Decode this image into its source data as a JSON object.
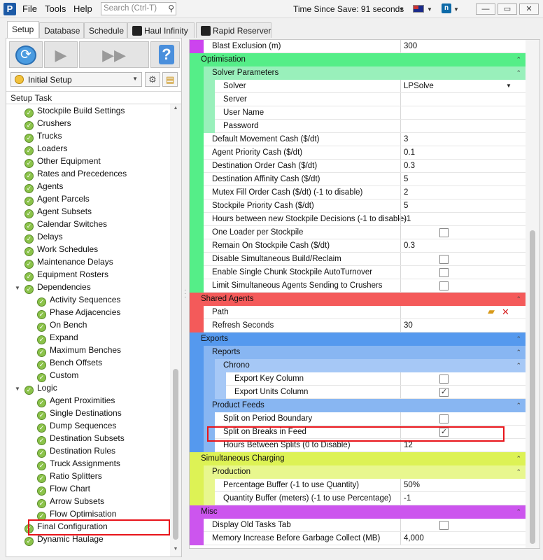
{
  "titlebar": {
    "logo_letter": "P",
    "menus": [
      "File",
      "Tools",
      "Help"
    ],
    "search_placeholder": "Search (Ctrl-T)",
    "time_since_save": "Time Since Save: 91 seconds",
    "window_buttons": [
      "—",
      "▭",
      "✕"
    ]
  },
  "tabs": [
    {
      "label": "Setup",
      "active": true
    },
    {
      "label": "Database",
      "active": false
    },
    {
      "label": "Schedule",
      "active": false
    },
    {
      "label": "Haul Infinity",
      "active": false
    },
    {
      "label": "Rapid Reserver",
      "active": false
    }
  ],
  "left": {
    "combo_value": "Initial Setup",
    "setup_task_header": "Setup Task",
    "tree": [
      {
        "label": "Stockpile Build Settings",
        "level": 1
      },
      {
        "label": "Crushers",
        "level": 1
      },
      {
        "label": "Trucks",
        "level": 1
      },
      {
        "label": "Loaders",
        "level": 1
      },
      {
        "label": "Other Equipment",
        "level": 1
      },
      {
        "label": "Rates and Precedences",
        "level": 1
      },
      {
        "label": "Agents",
        "level": 1
      },
      {
        "label": "Agent Parcels",
        "level": 1
      },
      {
        "label": "Agent Subsets",
        "level": 1
      },
      {
        "label": "Calendar Switches",
        "level": 1
      },
      {
        "label": "Delays",
        "level": 1
      },
      {
        "label": "Work Schedules",
        "level": 1
      },
      {
        "label": "Maintenance Delays",
        "level": 1
      },
      {
        "label": "Equipment Rosters",
        "level": 1
      },
      {
        "label": "Dependencies",
        "level": 1,
        "expandable": true
      },
      {
        "label": "Activity Sequences",
        "level": 2
      },
      {
        "label": "Phase Adjacencies",
        "level": 2
      },
      {
        "label": "On Bench",
        "level": 2
      },
      {
        "label": "Expand",
        "level": 2
      },
      {
        "label": "Maximum Benches",
        "level": 2
      },
      {
        "label": "Bench Offsets",
        "level": 2
      },
      {
        "label": "Custom",
        "level": 2
      },
      {
        "label": "Logic",
        "level": 1,
        "expandable": true
      },
      {
        "label": "Agent Proximities",
        "level": 2
      },
      {
        "label": "Single Destinations",
        "level": 2
      },
      {
        "label": "Dump Sequences",
        "level": 2
      },
      {
        "label": "Destination Subsets",
        "level": 2
      },
      {
        "label": "Destination Rules",
        "level": 2
      },
      {
        "label": "Truck Assignments",
        "level": 2
      },
      {
        "label": "Ratio Splitters",
        "level": 2
      },
      {
        "label": "Flow Chart",
        "level": 2
      },
      {
        "label": "Arrow Subsets",
        "level": 2
      },
      {
        "label": "Flow Optimisation",
        "level": 2
      },
      {
        "label": "Final Configuration",
        "level": 1,
        "highlighted": true
      },
      {
        "label": "Dynamic Haulage",
        "level": 1
      }
    ]
  },
  "grid": {
    "colors": {
      "magenta": "#cc44ee",
      "green": "#55ee88",
      "green_light": "#99f0bb",
      "red": "#f45a5a",
      "blue": "#5599ee",
      "blue_mid": "#88b6f2",
      "blue_light": "#a6c8f6",
      "yellow": "#ddf255",
      "yellow_light": "#e8f78e",
      "purple": "#cc55ee"
    },
    "rows": [
      {
        "kind": "prop",
        "label": "Blast Exclusion (m)",
        "value": "300",
        "indent": 1,
        "bars": [
          "magenta"
        ]
      },
      {
        "kind": "cat",
        "label": "Optimisation",
        "indent": 0,
        "color": "green"
      },
      {
        "kind": "cat",
        "label": "Solver Parameters",
        "indent": 1,
        "color": "green_light",
        "bars": [
          "green"
        ]
      },
      {
        "kind": "prop",
        "label": "Solver",
        "value": "LPSolve",
        "dropdown": true,
        "indent": 2,
        "bars": [
          "green",
          "green_light"
        ]
      },
      {
        "kind": "prop",
        "label": "Server",
        "value": "",
        "indent": 2,
        "bars": [
          "green",
          "green_light"
        ]
      },
      {
        "kind": "prop",
        "label": "User Name",
        "value": "",
        "indent": 2,
        "bars": [
          "green",
          "green_light"
        ]
      },
      {
        "kind": "prop",
        "label": "Password",
        "value": "",
        "indent": 2,
        "bars": [
          "green",
          "green_light"
        ]
      },
      {
        "kind": "prop",
        "label": "Default Movement Cash ($/dt)",
        "value": "3",
        "indent": 1,
        "bars": [
          "green"
        ]
      },
      {
        "kind": "prop",
        "label": "Agent Priority Cash ($/dt)",
        "value": "0.1",
        "indent": 1,
        "bars": [
          "green"
        ]
      },
      {
        "kind": "prop",
        "label": "Destination Order Cash ($/dt)",
        "value": "0.3",
        "indent": 1,
        "bars": [
          "green"
        ]
      },
      {
        "kind": "prop",
        "label": "Destination Affinity Cash ($/dt)",
        "value": "5",
        "indent": 1,
        "bars": [
          "green"
        ]
      },
      {
        "kind": "prop",
        "label": "Mutex Fill Order Cash ($/dt) (-1 to disable)",
        "value": "2",
        "indent": 1,
        "bars": [
          "green"
        ]
      },
      {
        "kind": "prop",
        "label": "Stockpile Priority Cash ($/dt)",
        "value": "5",
        "indent": 1,
        "bars": [
          "green"
        ]
      },
      {
        "kind": "prop",
        "label": "Hours between new Stockpile Decisions (-1 to disable)",
        "value": "-1",
        "indent": 1,
        "bars": [
          "green"
        ]
      },
      {
        "kind": "prop",
        "label": "One Loader per Stockpile",
        "checkbox": true,
        "checked": false,
        "indent": 1,
        "bars": [
          "green"
        ]
      },
      {
        "kind": "prop",
        "label": "Remain On Stockpile Cash ($/dt)",
        "value": "0.3",
        "indent": 1,
        "bars": [
          "green"
        ]
      },
      {
        "kind": "prop",
        "label": "Disable Simultaneous Build/Reclaim",
        "checkbox": true,
        "checked": false,
        "indent": 1,
        "bars": [
          "green"
        ]
      },
      {
        "kind": "prop",
        "label": "Enable Single Chunk Stockpile AutoTurnover",
        "checkbox": true,
        "checked": false,
        "indent": 1,
        "bars": [
          "green"
        ]
      },
      {
        "kind": "prop",
        "label": "Limit Simultaneous Agents Sending to Crushers",
        "checkbox": true,
        "checked": false,
        "indent": 1,
        "bars": [
          "green"
        ]
      },
      {
        "kind": "cat",
        "label": "Shared Agents",
        "indent": 0,
        "color": "red"
      },
      {
        "kind": "prop",
        "label": "Path",
        "value": "",
        "path_icons": true,
        "indent": 1,
        "bars": [
          "red"
        ]
      },
      {
        "kind": "prop",
        "label": "Refresh Seconds",
        "value": "30",
        "indent": 1,
        "bars": [
          "red"
        ]
      },
      {
        "kind": "cat",
        "label": "Exports",
        "indent": 0,
        "color": "blue"
      },
      {
        "kind": "cat",
        "label": "Reports",
        "indent": 1,
        "color": "blue_mid",
        "bars": [
          "blue"
        ]
      },
      {
        "kind": "cat",
        "label": "Chrono",
        "indent": 2,
        "color": "blue_light",
        "bars": [
          "blue",
          "blue_mid"
        ]
      },
      {
        "kind": "prop",
        "label": "Export Key Column",
        "checkbox": true,
        "checked": false,
        "indent": 3,
        "bars": [
          "blue",
          "blue_mid",
          "blue_light"
        ]
      },
      {
        "kind": "prop",
        "label": "Export Units Column",
        "checkbox": true,
        "checked": true,
        "indent": 3,
        "bars": [
          "blue",
          "blue_mid",
          "blue_light"
        ]
      },
      {
        "kind": "cat",
        "label": "Product Feeds",
        "indent": 1,
        "color": "blue_mid",
        "bars": [
          "blue"
        ]
      },
      {
        "kind": "prop",
        "label": "Split on Period Boundary",
        "checkbox": true,
        "checked": false,
        "indent": 2,
        "bars": [
          "blue",
          "blue_mid"
        ]
      },
      {
        "kind": "prop",
        "label": "Split on Breaks in Feed",
        "checkbox": true,
        "checked": true,
        "indent": 2,
        "bars": [
          "blue",
          "blue_mid"
        ],
        "highlighted": true
      },
      {
        "kind": "prop",
        "label": "Hours Between Splits (0 to Disable)",
        "value": "12",
        "indent": 2,
        "bars": [
          "blue",
          "blue_mid"
        ]
      },
      {
        "kind": "cat",
        "label": "Simultaneous Charging",
        "indent": 0,
        "color": "yellow"
      },
      {
        "kind": "cat",
        "label": "Production",
        "indent": 1,
        "color": "yellow_light",
        "bars": [
          "yellow"
        ]
      },
      {
        "kind": "prop",
        "label": "Percentage Buffer (-1 to use Quantity)",
        "value": "50%",
        "indent": 2,
        "bars": [
          "yellow",
          "yellow_light"
        ]
      },
      {
        "kind": "prop",
        "label": "Quantity Buffer (meters) (-1 to use Percentage)",
        "value": "-1",
        "indent": 2,
        "bars": [
          "yellow",
          "yellow_light"
        ]
      },
      {
        "kind": "cat",
        "label": "Misc",
        "indent": 0,
        "color": "purple"
      },
      {
        "kind": "prop",
        "label": "Display Old Tasks Tab",
        "checkbox": true,
        "checked": false,
        "indent": 1,
        "bars": [
          "purple"
        ]
      },
      {
        "kind": "prop",
        "label": "Memory Increase Before Garbage Collect (MB)",
        "value": "4,000",
        "indent": 1,
        "bars": [
          "purple"
        ]
      }
    ]
  }
}
